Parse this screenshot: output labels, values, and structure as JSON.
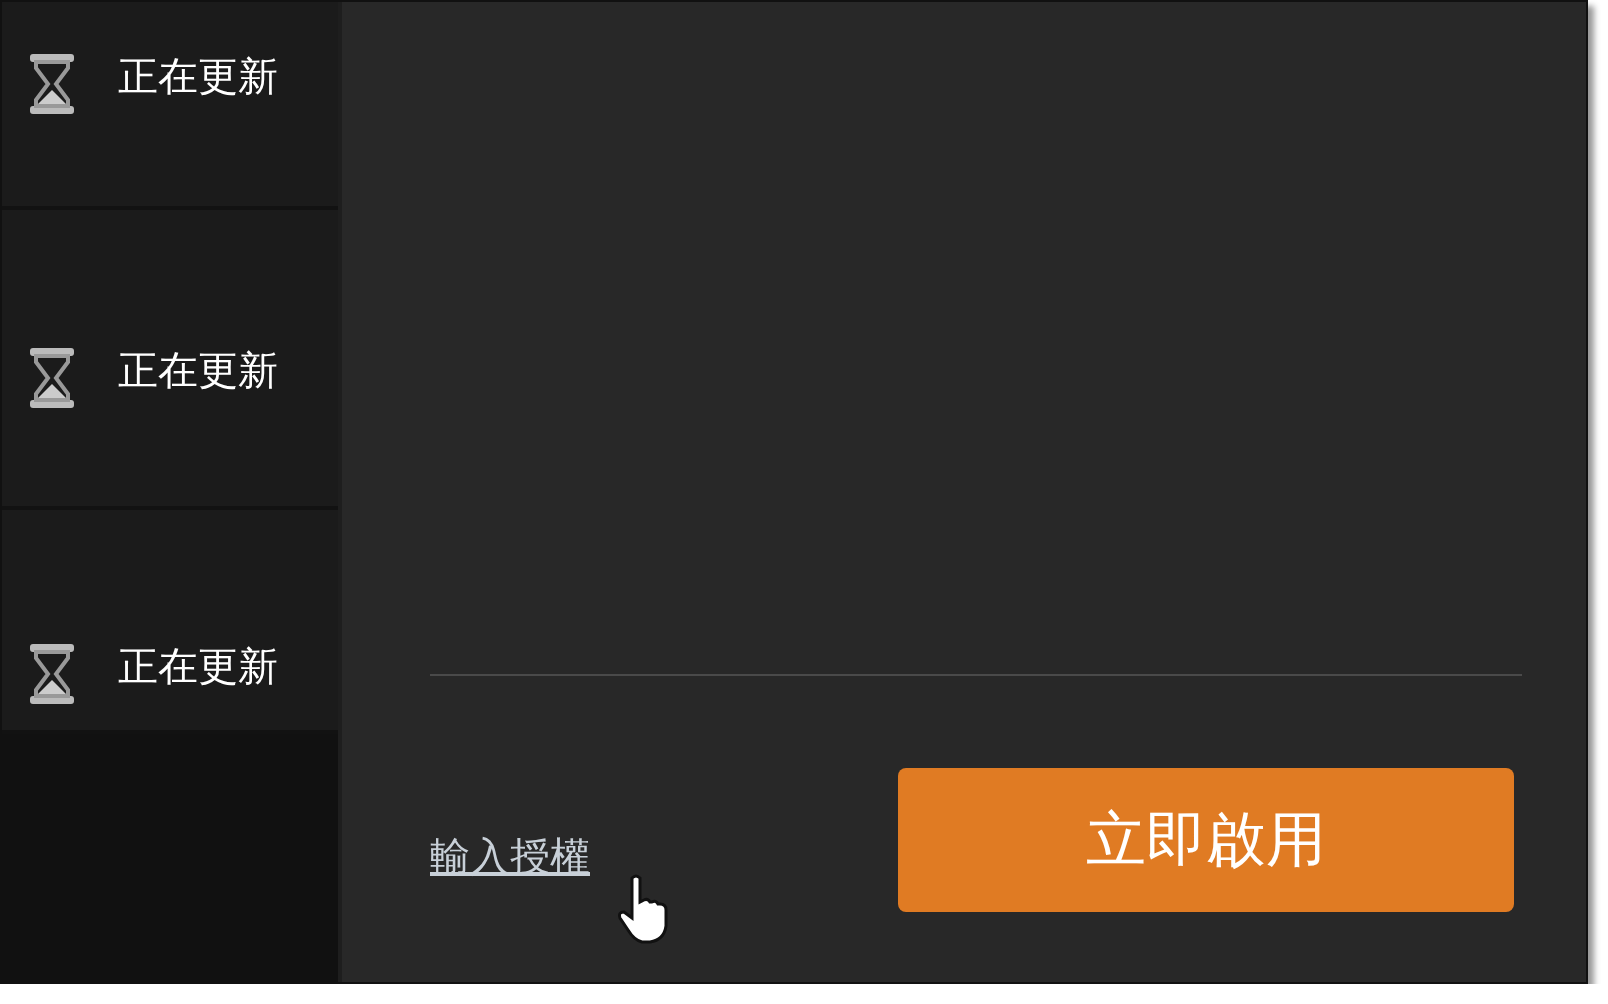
{
  "sidebar": {
    "items": [
      {
        "status": "正在更新"
      },
      {
        "status": "正在更新"
      },
      {
        "status": "正在更新"
      }
    ]
  },
  "footer": {
    "link": "輸入授權",
    "button": "立即啟用"
  }
}
